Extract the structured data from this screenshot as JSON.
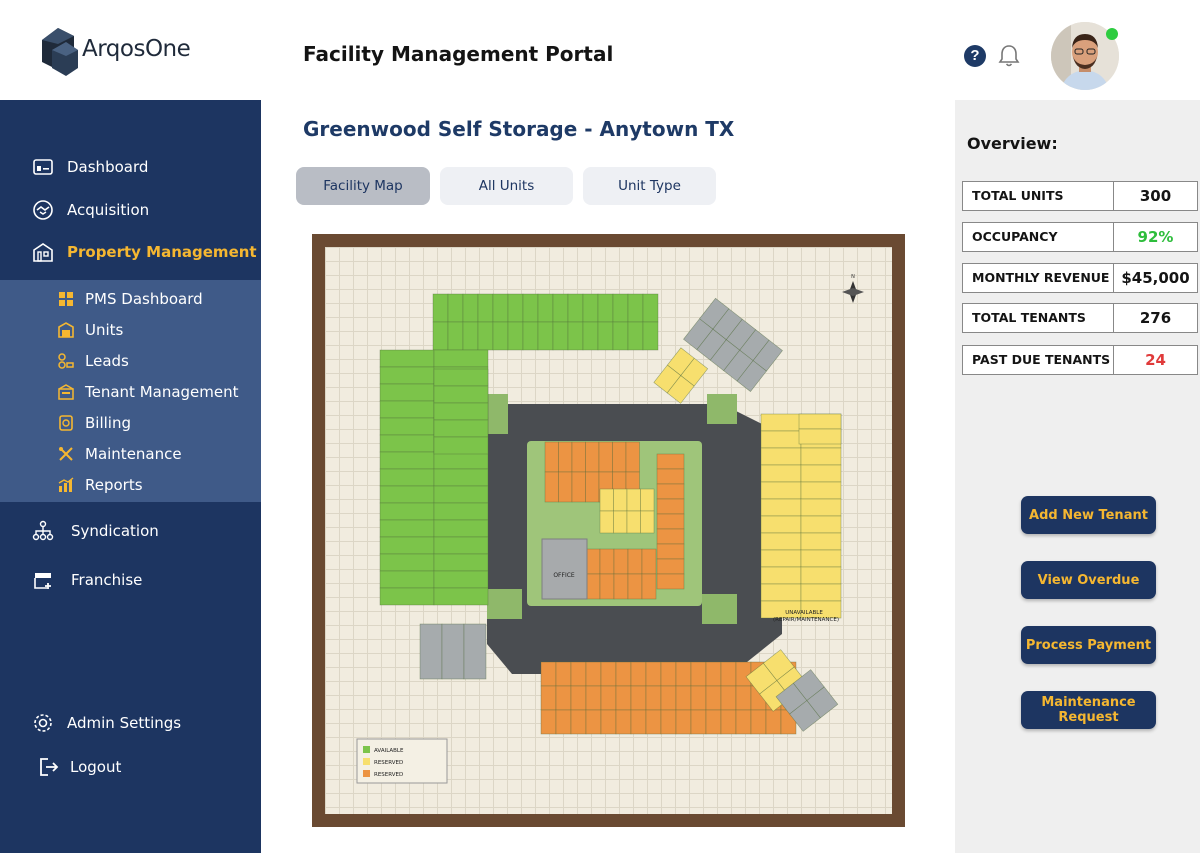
{
  "app": {
    "logo_text": "ArqosOne",
    "portal_title": "Facility Management Portal"
  },
  "header": {
    "help_label": "?"
  },
  "sidebar": {
    "items": [
      {
        "label": "Dashboard",
        "icon": "dashboard-icon"
      },
      {
        "label": "Acquisition",
        "icon": "handshake-icon"
      },
      {
        "label": "Property Management",
        "icon": "building-icon",
        "active": true
      },
      {
        "label": "Syndication",
        "icon": "network-icon"
      },
      {
        "label": "Franchise",
        "icon": "store-icon"
      }
    ],
    "sub_items": [
      {
        "label": "PMS Dashboard",
        "icon": "grid-icon"
      },
      {
        "label": "Units",
        "icon": "storage-unit-icon"
      },
      {
        "label": "Leads",
        "icon": "leads-icon"
      },
      {
        "label": "Tenant Management",
        "icon": "tenant-icon"
      },
      {
        "label": "Billing",
        "icon": "billing-icon"
      },
      {
        "label": "Maintenance",
        "icon": "tools-icon"
      },
      {
        "label": "Reports",
        "icon": "reports-icon"
      }
    ],
    "bottom": [
      {
        "label": "Admin Settings",
        "icon": "gear-icon"
      },
      {
        "label": "Logout",
        "icon": "logout-icon"
      }
    ]
  },
  "main": {
    "facility_title": "Greenwood Self Storage - Anytown TX",
    "tabs": [
      {
        "label": "Facility Map",
        "active": true
      },
      {
        "label": "All Units"
      },
      {
        "label": "Unit Type"
      }
    ],
    "map": {
      "office_label": "OFFICE",
      "legend": [
        "AVAILABLE",
        "RESERVED",
        "RESERVED"
      ],
      "unavailable_note_1": "UNAVAILABLE",
      "unavailable_note_2": "(REPAIR/MAINTENANCE)",
      "compass": "N"
    }
  },
  "overview": {
    "title": "Overview:",
    "stats": [
      {
        "label": "TOTAL UNITS",
        "value": "300",
        "color": "#141414"
      },
      {
        "label": "OCCUPANCY",
        "value": "92%",
        "color": "#2ebd3c"
      },
      {
        "label": "MONTHLY REVENUE",
        "value": "$45,000",
        "color": "#141414"
      },
      {
        "label": "TOTAL TENANTS",
        "value": "276",
        "color": "#141414"
      },
      {
        "label": "PAST DUE TENANTS",
        "value": "24",
        "color": "#e03a3a"
      }
    ],
    "actions": [
      {
        "label": "Add New Tenant"
      },
      {
        "label": "View Overdue"
      },
      {
        "label": "Process Payment"
      },
      {
        "label": "Maintenance Request"
      }
    ]
  },
  "colors": {
    "sidebar": "#1d3561",
    "sidebar_sub": "#3f5a88",
    "accent": "#f5b731",
    "available": "#7cc44a",
    "reserved_yellow": "#f7df6e",
    "reserved_orange": "#ec9443",
    "unavailable": "#a6abad"
  }
}
